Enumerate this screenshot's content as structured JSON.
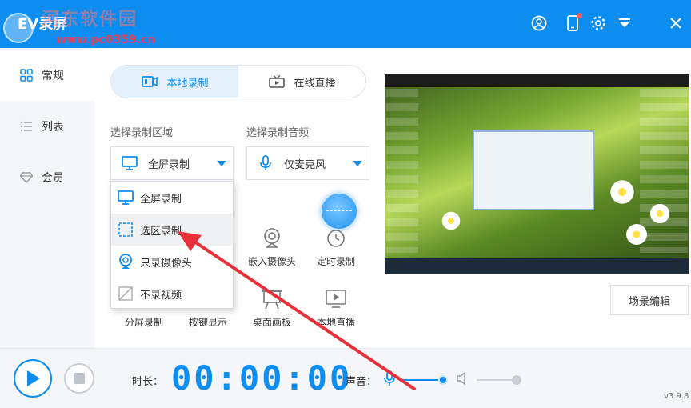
{
  "app": {
    "title": "EV录屏",
    "version": "v3.9.8"
  },
  "watermark": {
    "text": "河东软件园",
    "url": "www.pc0359.cn"
  },
  "colors": {
    "accent": "#0d8df0",
    "annotation": "#e8303a"
  },
  "titlebar": {
    "icons": [
      "user-icon",
      "phone-icon",
      "gear-icon",
      "dropdown-icon",
      "close-icon"
    ]
  },
  "sidebar": {
    "items": [
      {
        "label": "常规",
        "icon": "grid-icon",
        "active": true
      },
      {
        "label": "列表",
        "icon": "list-icon",
        "active": false
      },
      {
        "label": "会员",
        "icon": "diamond-icon",
        "active": false
      }
    ]
  },
  "tabs": [
    {
      "label": "本地录制",
      "icon": "video-camera-icon",
      "active": true
    },
    {
      "label": "在线直播",
      "icon": "tv-icon",
      "active": false
    }
  ],
  "area": {
    "label": "选择录制区域",
    "value": "全屏录制"
  },
  "audio": {
    "label": "选择录制音频",
    "value": "仅麦克风"
  },
  "dropdown": {
    "items": [
      {
        "label": "全屏录制",
        "icon": "monitor-icon"
      },
      {
        "label": "选区录制",
        "icon": "selection-icon",
        "hover": true
      },
      {
        "label": "只录摄像头",
        "icon": "webcam-icon"
      },
      {
        "label": "不录视频",
        "icon": "no-video-icon"
      }
    ]
  },
  "tools": [
    {
      "label": "嵌入摄像头",
      "icon": "webcam-icon"
    },
    {
      "label": "定时录制",
      "icon": "clock-icon"
    },
    {
      "label": "分屏录制",
      "icon": "split-icon"
    },
    {
      "label": "按键显示",
      "icon": "keyboard-icon"
    },
    {
      "label": "桌面画板",
      "icon": "easel-icon"
    },
    {
      "label": "本地直播",
      "icon": "play-screen-icon"
    }
  ],
  "scene_button": "场景编辑",
  "bottom": {
    "duration_label": "时长：",
    "timer": "00:00:00",
    "sound_label": "声音：",
    "mic_volume": 1.0,
    "system_volume": 1.0
  }
}
